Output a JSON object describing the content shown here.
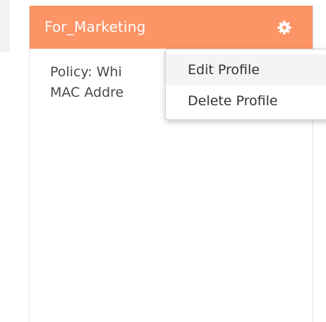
{
  "card": {
    "title": "For_Marketing",
    "header_color": "#fd9466",
    "settings_icon": "gear-icon",
    "body_lines": [
      "Policy: Whi",
      "MAC Addre"
    ]
  },
  "dropdown": {
    "items": [
      {
        "label": "Edit Profile",
        "hovered": true
      },
      {
        "label": "Delete Profile",
        "hovered": false
      }
    ]
  }
}
